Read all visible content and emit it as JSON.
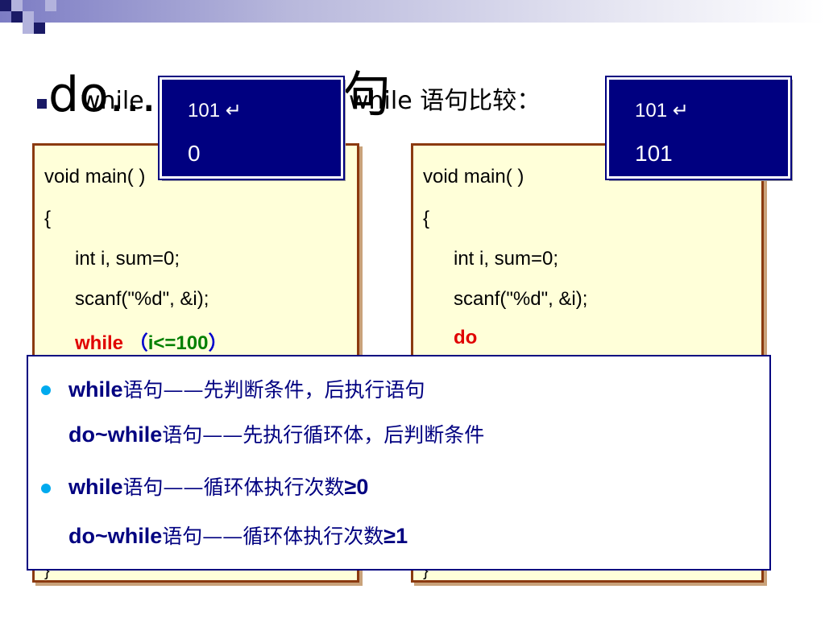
{
  "title": {
    "big_left": "do…",
    "small_left": "while",
    "small_right": "while 语句比较：",
    "big_right": "句"
  },
  "output_left": {
    "line1": "101 ↵",
    "line2": "0"
  },
  "output_right": {
    "line1": "101 ↵",
    "line2": "101"
  },
  "code_left": {
    "l1": "void main( )",
    "l2": "{",
    "l3": "int i,  sum=0;",
    "l4": "scanf(\"%d\", &i);",
    "l5_kw": "while",
    "l5_open": "（",
    "l5_cond": "i<=100",
    "l5_close": "）",
    "last": "}"
  },
  "code_right": {
    "l1": "void main( )",
    "l2": "{",
    "l3": "int i,  sum=0;",
    "l4": "scanf(\"%d\", &i);",
    "l5_kw": "do",
    "last": "}"
  },
  "summary": {
    "r1_kw": "while",
    "r1_cn": "语句——先判断条件，后执行语句",
    "r2_kw": "do~while",
    "r2_cn": "语句——先执行循环体，后判断条件",
    "r3_kw": "while",
    "r3_cn": "语句——循环体执行次数",
    "r3_val": "≥0",
    "r4_kw": "do~while",
    "r4_cn": "语句——循环体执行次数",
    "r4_val": "≥1"
  },
  "colors": {
    "navy": "#000080",
    "code_bg": "#ffffd9",
    "code_border": "#8b3a10",
    "keyword": "#e00000",
    "bullet": "#00aaee"
  }
}
